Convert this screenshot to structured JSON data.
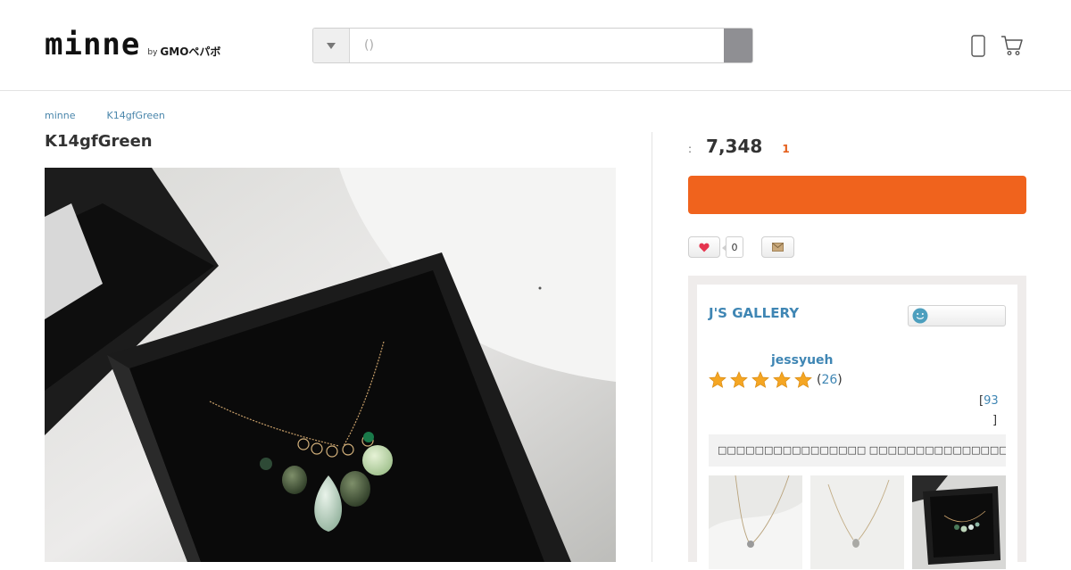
{
  "header": {
    "logo_text": "minne",
    "logo_by": "by",
    "logo_brand": "GMOペパボ",
    "search_placeholder": "()"
  },
  "breadcrumb": [
    {
      "label": "minne"
    },
    {
      "label": "K14gfGreen"
    }
  ],
  "product": {
    "title": "K14gfGreen",
    "price_colon": ":",
    "price": "7,348",
    "stock": "1",
    "cart_label": "",
    "like_count": "0"
  },
  "gallery": {
    "name": "J'S GALLERY",
    "follow_label": "",
    "owner": "jessyueh",
    "rating": 5,
    "review_count": "26",
    "items_open": "[",
    "items_count": "93",
    "items_close": "]",
    "description": "□□□□□□□□□□□□□□□□ □□□□□□□□□□□□□□□□□□□□↗□",
    "thumbnail_count": 3
  },
  "colors": {
    "accent_orange": "#f0631d",
    "link_blue": "#3f86b4",
    "star_gold": "#f5a623"
  }
}
